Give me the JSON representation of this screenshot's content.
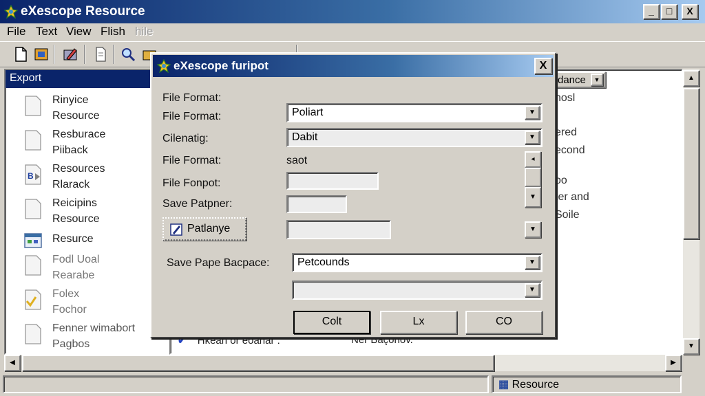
{
  "window": {
    "title": "eXescope Resource",
    "controls": {
      "minimize": "_",
      "maximize": "□",
      "close": "X"
    }
  },
  "menu": {
    "items": [
      {
        "label": "File",
        "enabled": true
      },
      {
        "label": "Text",
        "enabled": true
      },
      {
        "label": "View",
        "enabled": true
      },
      {
        "label": "Flish",
        "enabled": true
      },
      {
        "label": "hile",
        "enabled": false
      }
    ]
  },
  "toolbar": {
    "buttons": [
      "new-file-icon",
      "open-folder-icon",
      "edit-resource-icon",
      "document-icon",
      "search-icon",
      "folder-icon"
    ]
  },
  "left_pane": {
    "header": "Export",
    "items": [
      {
        "label": "Rinyice\nResource",
        "icon": "file-icon"
      },
      {
        "label": "Resburace\nPiiback",
        "icon": "file-icon"
      },
      {
        "label": "Resources\nRlarack",
        "icon": "binary-file-icon"
      },
      {
        "label": "Reicipins\nResource",
        "icon": "file-icon"
      },
      {
        "label": "Resurce",
        "icon": "window-resource-icon"
      },
      {
        "label": "Fodl Uoal\nRearabe",
        "icon": "file-icon"
      },
      {
        "label": "Folex\nFochor",
        "icon": "checked-file-icon"
      },
      {
        "label": "Fenner wimabort\nPagbos",
        "icon": "file-icon"
      }
    ]
  },
  "right_pane": {
    "column_header": "dance",
    "fragments": [
      "hosl",
      "ered",
      "econd",
      "oo",
      "ter and",
      "Soile"
    ],
    "bottom_row": {
      "col1": "Hkean or eoanar :",
      "col2": "Ner Baçonov."
    }
  },
  "statusbar": {
    "right_panel": "Resource"
  },
  "dialog": {
    "title": "eXescope furipot",
    "close": "X",
    "rows": {
      "heading_label": "File Format:",
      "format_label": "File Format:",
      "format_value": "Poliart",
      "cilenatig_label": "Cilenatig:",
      "cilenatig_value": "Dabit",
      "format2_label": "File Format:",
      "format2_value": "saot",
      "fontpot_label": "File Fonpot:",
      "patpner_label": "Save Patpner:",
      "patlanye_button": "Patlanye",
      "save_space_label": "Save Pape Bacpace:",
      "save_space_value": "Petcounds"
    },
    "buttons": {
      "ok": "Colt",
      "middle": "Lx",
      "cancel": "CO"
    }
  },
  "colors": {
    "titlebar_start": "#0a246a",
    "titlebar_end": "#a6caf0",
    "face": "#d4d0c8",
    "selection": "#0a246a"
  }
}
